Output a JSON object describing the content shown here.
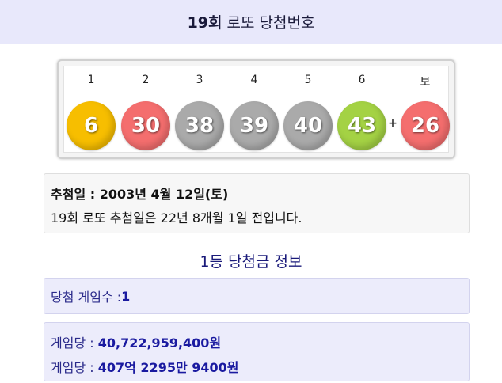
{
  "header": {
    "round": "19회",
    "title": "로또 당첨번호"
  },
  "balls": {
    "labels": [
      "1",
      "2",
      "3",
      "4",
      "5",
      "6",
      "보"
    ],
    "numbers": [
      {
        "value": "6",
        "color": "#f7be00"
      },
      {
        "value": "30",
        "color": "#f46e6e"
      },
      {
        "value": "38",
        "color": "#aaaaaa"
      },
      {
        "value": "39",
        "color": "#aaaaaa"
      },
      {
        "value": "40",
        "color": "#aaaaaa"
      },
      {
        "value": "43",
        "color": "#a4d244"
      }
    ],
    "plus": "+",
    "bonus": {
      "value": "26",
      "color": "#f46e6e"
    }
  },
  "info": {
    "draw_date": "추첨일 : 2003년 4월 12일(토)",
    "elapsed": "19회 로또 추첨일은 22년 8개월 1일 전입니다."
  },
  "prize": {
    "section_title": "1등 당첨금 정보",
    "winners_label": "당첨 게임수 : ",
    "winners_value": "1",
    "per_game_label_1": "게임당 : ",
    "per_game_value_1": "40,722,959,400원",
    "per_game_label_2": "게임당 : ",
    "per_game_value_2": "407억 2295만 9400원"
  }
}
